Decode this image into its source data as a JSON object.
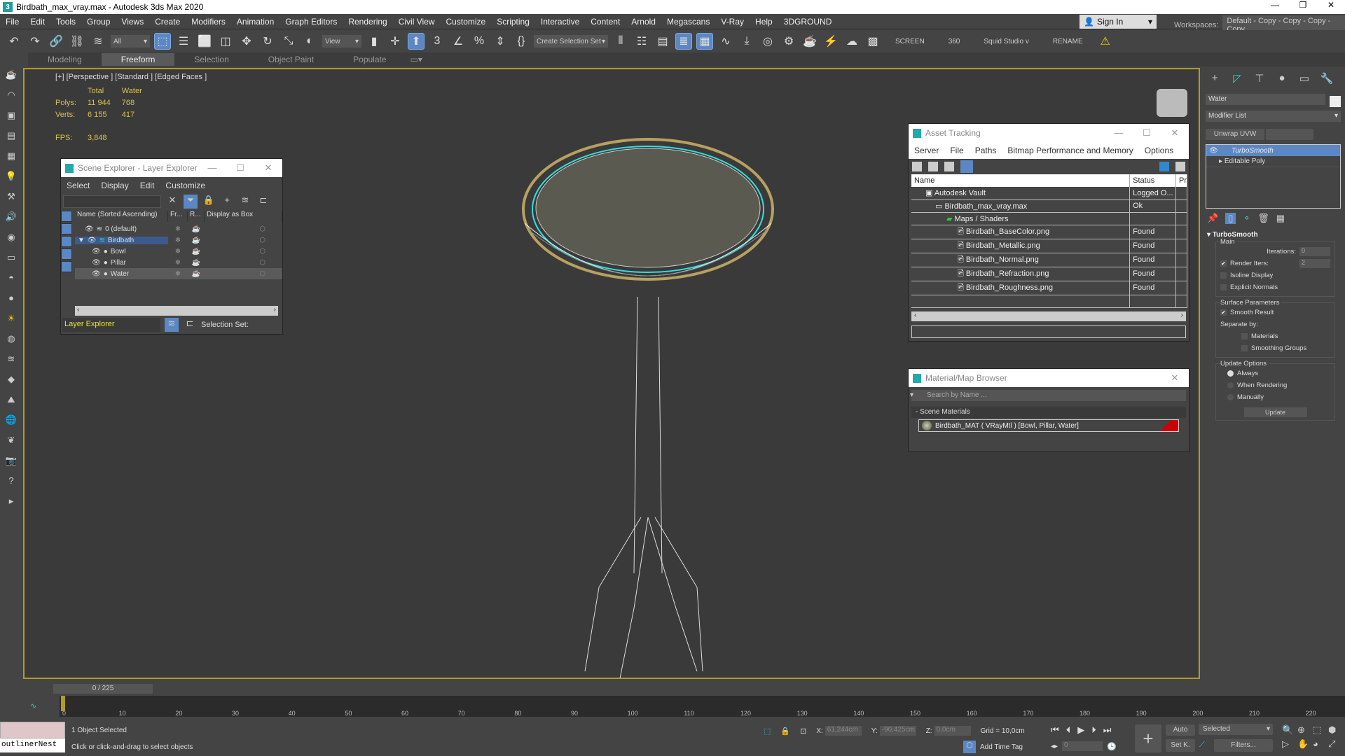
{
  "window": {
    "title": "Birdbath_max_vray.max - Autodesk 3ds Max 2020",
    "logo": "3"
  },
  "menu": [
    "File",
    "Edit",
    "Tools",
    "Group",
    "Views",
    "Create",
    "Modifiers",
    "Animation",
    "Graph Editors",
    "Rendering",
    "Civil View",
    "Customize",
    "Scripting",
    "Interactive",
    "Content",
    "Arnold",
    "Megascans",
    "V-Ray",
    "Help",
    "3DGROUND"
  ],
  "account": {
    "signin": "Sign In",
    "workspaces_label": "Workspaces:",
    "workspace": "Default - Copy - Copy - Copy - Copy"
  },
  "toolbar": {
    "filter": "All",
    "refcoord": "View",
    "selection_set": "Create Selection Set",
    "screen": "SCREEN",
    "n360": "360",
    "squid": "Squid Studio v",
    "rename": "RENAME"
  },
  "ribbon": {
    "tabs": [
      "Modeling",
      "Freeform",
      "Selection",
      "Object Paint",
      "Populate"
    ],
    "active": "Freeform"
  },
  "viewport": {
    "label": "[+] [Perspective ] [Standard ] [Edged Faces ]",
    "stats": {
      "col_total": "Total",
      "col_sel": "Water",
      "polys_label": "Polys:",
      "polys_total": "11 944",
      "polys_sel": "768",
      "verts_label": "Verts:",
      "verts_total": "6 155",
      "verts_sel": "417",
      "fps_label": "FPS:",
      "fps": "3,848"
    }
  },
  "scene_explorer": {
    "title": "Scene Explorer - Layer Explorer",
    "menu": [
      "Select",
      "Display",
      "Edit",
      "Customize"
    ],
    "columns": [
      "Name (Sorted Ascending)",
      "Fr...",
      "R...",
      "Display as Box"
    ],
    "rows": [
      {
        "name": "0 (default)",
        "type": "layer"
      },
      {
        "name": "Birdbath",
        "type": "layer",
        "selected": true
      },
      {
        "name": "Bowl",
        "type": "object"
      },
      {
        "name": "Pillar",
        "type": "object"
      },
      {
        "name": "Water",
        "type": "object",
        "highlight": true
      }
    ],
    "explorer_type": "Layer Explorer",
    "selection_set_label": "Selection Set:"
  },
  "asset_tracking": {
    "title": "Asset Tracking",
    "menu": [
      "Server",
      "File",
      "Paths",
      "Bitmap Performance and Memory",
      "Options"
    ],
    "columns": [
      "Name",
      "Status",
      "Pr"
    ],
    "rows": [
      {
        "name": "Autodesk Vault",
        "status": "Logged O...",
        "indent": 1
      },
      {
        "name": "Birdbath_max_vray.max",
        "status": "Ok",
        "indent": 2
      },
      {
        "name": "Maps / Shaders",
        "status": "",
        "indent": 3
      },
      {
        "name": "Birdbath_BaseColor.png",
        "status": "Found",
        "indent": 4
      },
      {
        "name": "Birdbath_Metallic.png",
        "status": "Found",
        "indent": 4
      },
      {
        "name": "Birdbath_Normal.png",
        "status": "Found",
        "indent": 4
      },
      {
        "name": "Birdbath_Refraction.png",
        "status": "Found",
        "indent": 4
      },
      {
        "name": "Birdbath_Roughness.png",
        "status": "Found",
        "indent": 4
      }
    ]
  },
  "material_browser": {
    "title": "Material/Map Browser",
    "search_placeholder": "Search by Name ...",
    "group": "- Scene Materials",
    "material": "Birdbath_MAT  ( VRayMtl ) [Bowl, Pillar, Water]"
  },
  "command_panel": {
    "object_name": "Water",
    "modifier_list": "Modifier List",
    "unwrap": "Unwrap UVW",
    "stack": [
      "TurboSmooth",
      "Editable Poly"
    ],
    "rollout": "TurboSmooth",
    "main": "Main",
    "iterations_label": "Iterations:",
    "iterations": "0",
    "render_iters_label": "Render Iters:",
    "render_iters": "2",
    "isoline": "Isoline Display",
    "explicit": "Explicit Normals",
    "surface": "Surface Parameters",
    "smooth_result": "Smooth Result",
    "separate": "Separate by:",
    "materials": "Materials",
    "smoothing_groups": "Smoothing Groups",
    "update_options": "Update Options",
    "always": "Always",
    "when_rendering": "When Rendering",
    "manually": "Manually",
    "update": "Update"
  },
  "timeline": {
    "frame": "0 / 225",
    "ticks": [
      "0",
      "10",
      "20",
      "30",
      "40",
      "50",
      "60",
      "70",
      "80",
      "90",
      "100",
      "110",
      "120",
      "130",
      "140",
      "150",
      "160",
      "170",
      "180",
      "190",
      "200",
      "210",
      "220"
    ]
  },
  "status": {
    "maxscript": "outlinerNest",
    "selected": "1 Object Selected",
    "prompt": "Click or click-and-drag to select objects",
    "x_label": "X:",
    "x": "61,244cm",
    "y_label": "Y:",
    "y": "-90,425cm",
    "z_label": "Z:",
    "z": "0,0cm",
    "grid": "Grid = 10,0cm",
    "add_time_tag": "Add Time Tag",
    "current_frame": "0",
    "auto": "Auto",
    "setkey": "Set K.",
    "key_filter": "Selected",
    "filters": "Filters..."
  }
}
